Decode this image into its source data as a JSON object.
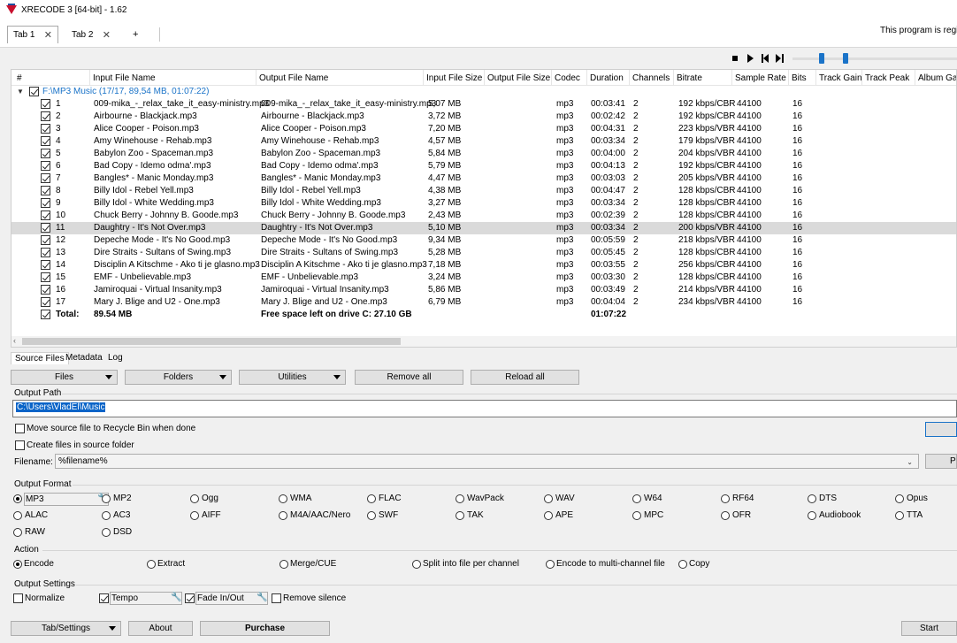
{
  "window": {
    "title": "XRECODE 3 [64-bit] - 1.62"
  },
  "tabs": [
    {
      "label": "Tab 1",
      "close": "✕"
    },
    {
      "label": "Tab 2",
      "close": "✕"
    }
  ],
  "tab_add": "+",
  "notice": "This program is regis",
  "grid": {
    "columns": [
      "#",
      "Input File Name",
      "Output File Name",
      "Input File Size",
      "Output File Size",
      "Codec",
      "Duration",
      "Channels",
      "Bitrate",
      "Sample Rate",
      "Bits",
      "Track Gain",
      "Track Peak",
      "Album Gai"
    ],
    "group_label": "F:\\MP3 Music (17/17, 89,54 MB, 01:07:22)",
    "rows": [
      {
        "n": "1",
        "input": "009-mika_-_relax_take_it_easy-ministry.mp3",
        "output": "009-mika_-_relax_take_it_easy-ministry.mp3",
        "size": "5,07 MB",
        "codec": "mp3",
        "duration": "00:03:41",
        "channels": "2",
        "bitrate": "192 kbps/CBR",
        "sample_rate": "44100",
        "bits": "16"
      },
      {
        "n": "2",
        "input": "Airbourne - Blackjack.mp3",
        "output": "Airbourne - Blackjack.mp3",
        "size": "3,72 MB",
        "codec": "mp3",
        "duration": "00:02:42",
        "channels": "2",
        "bitrate": "192 kbps/CBR",
        "sample_rate": "44100",
        "bits": "16"
      },
      {
        "n": "3",
        "input": "Alice Cooper - Poison.mp3",
        "output": "Alice Cooper - Poison.mp3",
        "size": "7,20 MB",
        "codec": "mp3",
        "duration": "00:04:31",
        "channels": "2",
        "bitrate": "223 kbps/VBR",
        "sample_rate": "44100",
        "bits": "16"
      },
      {
        "n": "4",
        "input": "Amy Winehouse - Rehab.mp3",
        "output": "Amy Winehouse - Rehab.mp3",
        "size": "4,57 MB",
        "codec": "mp3",
        "duration": "00:03:34",
        "channels": "2",
        "bitrate": "179 kbps/VBR",
        "sample_rate": "44100",
        "bits": "16"
      },
      {
        "n": "5",
        "input": "Babylon Zoo - Spaceman.mp3",
        "output": "Babylon Zoo - Spaceman.mp3",
        "size": "5,84 MB",
        "codec": "mp3",
        "duration": "00:04:00",
        "channels": "2",
        "bitrate": "204 kbps/VBR",
        "sample_rate": "44100",
        "bits": "16"
      },
      {
        "n": "6",
        "input": "Bad Copy - Idemo odma'.mp3",
        "output": "Bad Copy - Idemo odma'.mp3",
        "size": "5,79 MB",
        "codec": "mp3",
        "duration": "00:04:13",
        "channels": "2",
        "bitrate": "192 kbps/CBR",
        "sample_rate": "44100",
        "bits": "16"
      },
      {
        "n": "7",
        "input": "Bangles* - Manic Monday.mp3",
        "output": "Bangles* - Manic Monday.mp3",
        "size": "4,47 MB",
        "codec": "mp3",
        "duration": "00:03:03",
        "channels": "2",
        "bitrate": "205 kbps/VBR",
        "sample_rate": "44100",
        "bits": "16"
      },
      {
        "n": "8",
        "input": "Billy Idol - Rebel Yell.mp3",
        "output": "Billy Idol - Rebel Yell.mp3",
        "size": "4,38 MB",
        "codec": "mp3",
        "duration": "00:04:47",
        "channels": "2",
        "bitrate": "128 kbps/CBR",
        "sample_rate": "44100",
        "bits": "16"
      },
      {
        "n": "9",
        "input": "Billy Idol - White Wedding.mp3",
        "output": "Billy Idol - White Wedding.mp3",
        "size": "3,27 MB",
        "codec": "mp3",
        "duration": "00:03:34",
        "channels": "2",
        "bitrate": "128 kbps/CBR",
        "sample_rate": "44100",
        "bits": "16"
      },
      {
        "n": "10",
        "input": "Chuck Berry - Johnny B. Goode.mp3",
        "output": "Chuck Berry - Johnny B. Goode.mp3",
        "size": "2,43 MB",
        "codec": "mp3",
        "duration": "00:02:39",
        "channels": "2",
        "bitrate": "128 kbps/CBR",
        "sample_rate": "44100",
        "bits": "16"
      },
      {
        "n": "11",
        "input": "Daughtry - It's Not Over.mp3",
        "output": "Daughtry - It's Not Over.mp3",
        "size": "5,10 MB",
        "codec": "mp3",
        "duration": "00:03:34",
        "channels": "2",
        "bitrate": "200 kbps/VBR",
        "sample_rate": "44100",
        "bits": "16",
        "selected": true
      },
      {
        "n": "12",
        "input": "Depeche Mode - It's No Good.mp3",
        "output": "Depeche Mode - It's No Good.mp3",
        "size": "9,34 MB",
        "codec": "mp3",
        "duration": "00:05:59",
        "channels": "2",
        "bitrate": "218 kbps/VBR",
        "sample_rate": "44100",
        "bits": "16"
      },
      {
        "n": "13",
        "input": "Dire Straits - Sultans of Swing.mp3",
        "output": "Dire Straits - Sultans of Swing.mp3",
        "size": "5,28 MB",
        "codec": "mp3",
        "duration": "00:05:45",
        "channels": "2",
        "bitrate": "128 kbps/CBR",
        "sample_rate": "44100",
        "bits": "16"
      },
      {
        "n": "14",
        "input": "Disciplin A Kitschme - Ako ti je glasno.mp3",
        "output": "Disciplin A Kitschme - Ako ti je glasno.mp3",
        "size": "7,18 MB",
        "codec": "mp3",
        "duration": "00:03:55",
        "channels": "2",
        "bitrate": "256 kbps/CBR",
        "sample_rate": "44100",
        "bits": "16"
      },
      {
        "n": "15",
        "input": "EMF - Unbelievable.mp3",
        "output": "EMF - Unbelievable.mp3",
        "size": "3,24 MB",
        "codec": "mp3",
        "duration": "00:03:30",
        "channels": "2",
        "bitrate": "128 kbps/CBR",
        "sample_rate": "44100",
        "bits": "16"
      },
      {
        "n": "16",
        "input": "Jamiroquai - Virtual Insanity.mp3",
        "output": "Jamiroquai - Virtual Insanity.mp3",
        "size": "5,86 MB",
        "codec": "mp3",
        "duration": "00:03:49",
        "channels": "2",
        "bitrate": "214 kbps/VBR",
        "sample_rate": "44100",
        "bits": "16"
      },
      {
        "n": "17",
        "input": "Mary J. Blige and U2 - One.mp3",
        "output": "Mary J. Blige and U2 - One.mp3",
        "size": "6,79 MB",
        "codec": "mp3",
        "duration": "00:04:04",
        "channels": "2",
        "bitrate": "234 kbps/VBR",
        "sample_rate": "44100",
        "bits": "16"
      }
    ],
    "total": {
      "label": "Total:",
      "size": "89.54 MB",
      "free_space": "Free space left on drive C: 27.10 GB",
      "duration": "01:07:22"
    }
  },
  "subtabs": [
    "Source Files",
    "Metadata",
    "Log"
  ],
  "toolbar": {
    "files": "Files",
    "folders": "Folders",
    "utilities": "Utilities",
    "remove_all": "Remove all",
    "reload_all": "Reload all"
  },
  "output_path": {
    "header": "Output Path",
    "value": "C:\\Users\\VladEl\\Music",
    "move_to_recycle": "Move source file to Recycle Bin when done",
    "create_in_source": "Create files in source folder",
    "filename_label": "Filename:",
    "filename_value": "%filename%",
    "right_btn": "P"
  },
  "output_format": {
    "header": "Output Format",
    "selected": "MP3",
    "formats": [
      "MP3",
      "MP2",
      "Ogg",
      "WMA",
      "FLAC",
      "WavPack",
      "WAV",
      "W64",
      "RF64",
      "DTS",
      "Opus",
      "ALAC",
      "AC3",
      "AIFF",
      "M4A/AAC/Nero",
      "SWF",
      "TAK",
      "APE",
      "MPC",
      "OFR",
      "Audiobook",
      "TTA",
      "RAW",
      "DSD"
    ]
  },
  "action": {
    "header": "Action",
    "selected": "Encode",
    "options": [
      "Encode",
      "Extract",
      "Merge/CUE",
      "Split into file per channel",
      "Encode to multi-channel file",
      "Copy"
    ]
  },
  "output_settings": {
    "header": "Output Settings",
    "normalize": "Normalize",
    "tempo": "Tempo",
    "fade": "Fade In/Out",
    "remove_silence": "Remove silence"
  },
  "bottom": {
    "tab_settings": "Tab/Settings",
    "about": "About",
    "purchase": "Purchase",
    "start": "Start"
  },
  "icons": {
    "wrench": "wrench-icon",
    "check": "check-icon"
  },
  "colors": {
    "accent": "#1a73c8",
    "selection": "#0a64c8",
    "logo_red": "#c8102e"
  }
}
